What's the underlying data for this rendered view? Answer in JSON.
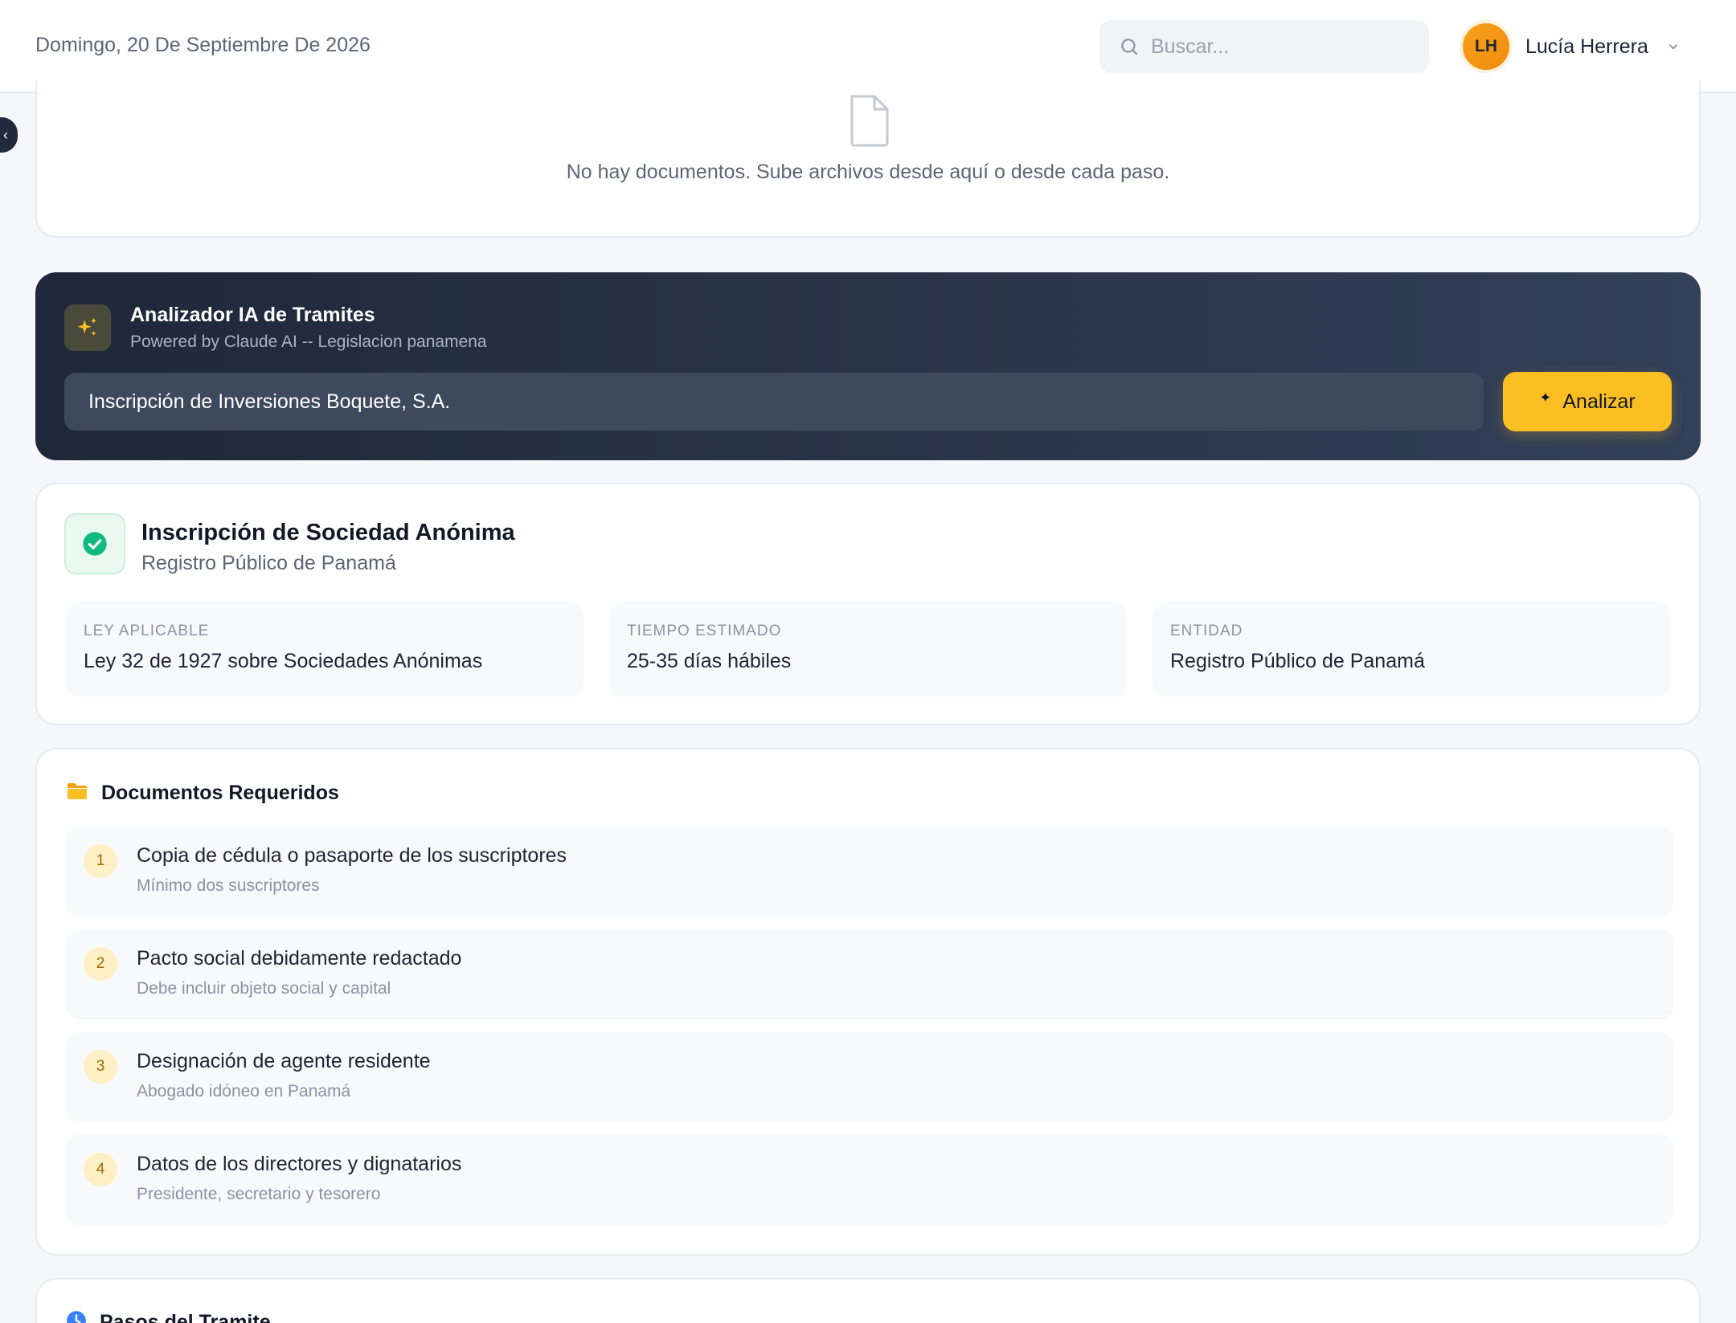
{
  "header": {
    "date": "Domingo, 20 De Septiembre De 2026",
    "search_placeholder": "Buscar...",
    "user": {
      "initials": "LH",
      "name": "Lucía Herrera"
    }
  },
  "uploads": {
    "empty_message": "No hay documentos. Sube archivos desde aquí o desde cada paso."
  },
  "analyzer": {
    "title": "Analizador IA de Tramites",
    "subtitle": "Powered by Claude AI -- Legislacion panamena",
    "input_value": "Inscripción de Inversiones Boquete, S.A.",
    "button_label": "Analizar"
  },
  "result": {
    "title": "Inscripción de Sociedad Anónima",
    "subtitle": "Registro Público de Panamá",
    "info": [
      {
        "label": "LEY APLICABLE",
        "value": "Ley 32 de 1927 sobre Sociedades Anónimas"
      },
      {
        "label": "TIEMPO ESTIMADO",
        "value": "25-35 días hábiles"
      },
      {
        "label": "ENTIDAD",
        "value": "Registro Público de Panamá"
      }
    ]
  },
  "documents": {
    "title": "Documentos Requeridos",
    "items": [
      {
        "num": "1",
        "title": "Copia de cédula o pasaporte de los suscriptores",
        "note": "Mínimo dos suscriptores"
      },
      {
        "num": "2",
        "title": "Pacto social debidamente redactado",
        "note": "Debe incluir objeto social y capital"
      },
      {
        "num": "3",
        "title": "Designación de agente residente",
        "note": "Abogado idóneo en Panamá"
      },
      {
        "num": "4",
        "title": "Datos de los directores y dignatarios",
        "note": "Presidente, secretario y tesorero"
      }
    ]
  },
  "steps": {
    "title": "Pasos del Tramite"
  },
  "colors": {
    "accent": "#fbbf24",
    "dark_panel": "#1d283a",
    "success": "#10b981",
    "step_icon": "#3b82f6"
  }
}
